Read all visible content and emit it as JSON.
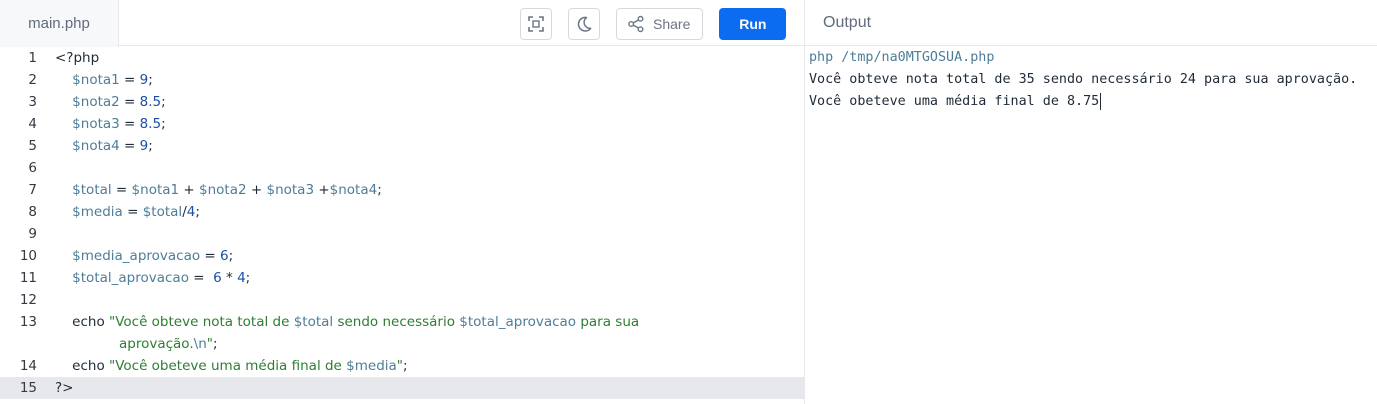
{
  "editor": {
    "file_tab": "main.php",
    "lines": [
      {
        "n": "1",
        "tokens": [
          {
            "t": "kw",
            "v": "<?php"
          }
        ]
      },
      {
        "n": "2",
        "tokens": [
          {
            "t": "kw",
            "v": "    "
          },
          {
            "t": "var",
            "v": "$nota1"
          },
          {
            "t": "op",
            "v": " = "
          },
          {
            "t": "num",
            "v": "9"
          },
          {
            "t": "op",
            "v": ";"
          }
        ]
      },
      {
        "n": "3",
        "tokens": [
          {
            "t": "kw",
            "v": "    "
          },
          {
            "t": "var",
            "v": "$nota2"
          },
          {
            "t": "op",
            "v": " = "
          },
          {
            "t": "num",
            "v": "8.5"
          },
          {
            "t": "op",
            "v": ";"
          }
        ]
      },
      {
        "n": "4",
        "tokens": [
          {
            "t": "kw",
            "v": "    "
          },
          {
            "t": "var",
            "v": "$nota3"
          },
          {
            "t": "op",
            "v": " = "
          },
          {
            "t": "num",
            "v": "8.5"
          },
          {
            "t": "op",
            "v": ";"
          }
        ]
      },
      {
        "n": "5",
        "tokens": [
          {
            "t": "kw",
            "v": "    "
          },
          {
            "t": "var",
            "v": "$nota4"
          },
          {
            "t": "op",
            "v": " = "
          },
          {
            "t": "num",
            "v": "9"
          },
          {
            "t": "op",
            "v": ";"
          }
        ]
      },
      {
        "n": "6",
        "tokens": []
      },
      {
        "n": "7",
        "tokens": [
          {
            "t": "kw",
            "v": "    "
          },
          {
            "t": "var",
            "v": "$total"
          },
          {
            "t": "op",
            "v": " = "
          },
          {
            "t": "var",
            "v": "$nota1"
          },
          {
            "t": "op",
            "v": " + "
          },
          {
            "t": "var",
            "v": "$nota2"
          },
          {
            "t": "op",
            "v": " + "
          },
          {
            "t": "var",
            "v": "$nota3"
          },
          {
            "t": "op",
            "v": " +"
          },
          {
            "t": "var",
            "v": "$nota4"
          },
          {
            "t": "op",
            "v": ";"
          }
        ]
      },
      {
        "n": "8",
        "tokens": [
          {
            "t": "kw",
            "v": "    "
          },
          {
            "t": "var",
            "v": "$media"
          },
          {
            "t": "op",
            "v": " = "
          },
          {
            "t": "var",
            "v": "$total"
          },
          {
            "t": "op",
            "v": "/"
          },
          {
            "t": "num",
            "v": "4"
          },
          {
            "t": "op",
            "v": ";"
          }
        ]
      },
      {
        "n": "9",
        "tokens": []
      },
      {
        "n": "10",
        "tokens": [
          {
            "t": "kw",
            "v": "    "
          },
          {
            "t": "var",
            "v": "$media_aprovacao"
          },
          {
            "t": "op",
            "v": " = "
          },
          {
            "t": "num",
            "v": "6"
          },
          {
            "t": "op",
            "v": ";"
          }
        ]
      },
      {
        "n": "11",
        "tokens": [
          {
            "t": "kw",
            "v": "    "
          },
          {
            "t": "var",
            "v": "$total_aprovacao"
          },
          {
            "t": "op",
            "v": " =  "
          },
          {
            "t": "num",
            "v": "6"
          },
          {
            "t": "op",
            "v": " * "
          },
          {
            "t": "num",
            "v": "4"
          },
          {
            "t": "op",
            "v": ";"
          }
        ]
      },
      {
        "n": "12",
        "tokens": []
      },
      {
        "n": "13",
        "tokens": [
          {
            "t": "kw",
            "v": "    echo "
          },
          {
            "t": "str",
            "v": "\"Você obteve nota total de "
          },
          {
            "t": "var",
            "v": "$total"
          },
          {
            "t": "str",
            "v": " sendo necessário "
          },
          {
            "t": "var",
            "v": "$total_aprovacao"
          },
          {
            "t": "str",
            "v": " para sua"
          }
        ],
        "wrap": [
          {
            "t": "str",
            "v": "aprovação."
          },
          {
            "t": "var",
            "v": "\\n"
          },
          {
            "t": "str",
            "v": "\""
          },
          {
            "t": "op",
            "v": ";"
          }
        ]
      },
      {
        "n": "14",
        "tokens": [
          {
            "t": "kw",
            "v": "    echo "
          },
          {
            "t": "str",
            "v": "\"Você obeteve uma média final de "
          },
          {
            "t": "var",
            "v": "$media"
          },
          {
            "t": "str",
            "v": "\""
          },
          {
            "t": "op",
            "v": ";"
          }
        ]
      },
      {
        "n": "15",
        "active": true,
        "tokens": [
          {
            "t": "kw",
            "v": "?>"
          }
        ]
      }
    ]
  },
  "toolbar": {
    "share_label": "Share",
    "run_label": "Run",
    "fullscreen_icon": "fullscreen-icon",
    "theme_icon": "moon-icon",
    "share_icon": "share-icon"
  },
  "output": {
    "tab_label": "Output",
    "command": "php /tmp/na0MTGOSUA.php",
    "lines": [
      "Você obteve nota total de 35 sendo necessário 24 para sua aprovação.",
      "Você obeteve uma média final de 8.75"
    ]
  },
  "colors": {
    "run_button": "#0b6cf1",
    "variable": "#4e7d99",
    "number": "#1c4ea8",
    "string": "#2f7d32",
    "active_line": "#e6e8eb"
  }
}
